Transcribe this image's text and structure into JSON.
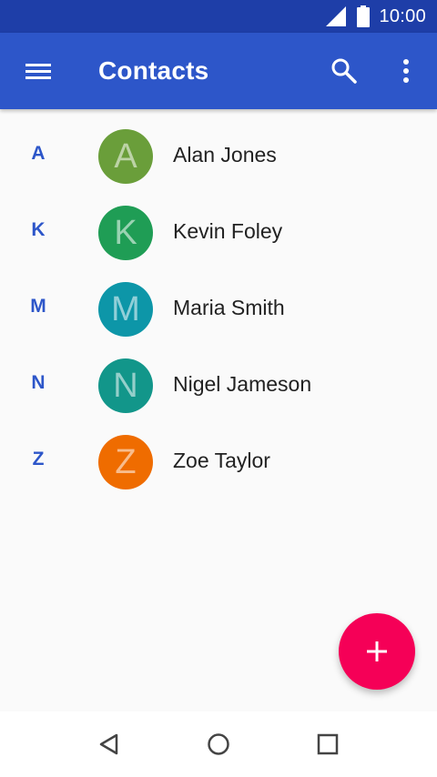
{
  "status_bar": {
    "time": "10:00",
    "signal_icon": "signal-full-icon",
    "battery_icon": "battery-full-icon"
  },
  "app_bar": {
    "title": "Contacts",
    "menu_icon": "hamburger-menu-icon",
    "search_icon": "search-icon",
    "more_icon": "more-vert-icon",
    "background": "#2d56c9"
  },
  "contacts": [
    {
      "section": "A",
      "initial": "A",
      "name": "Alan Jones",
      "color": "#6a9e3a"
    },
    {
      "section": "K",
      "initial": "K",
      "name": "Kevin Foley",
      "color": "#1f9d55"
    },
    {
      "section": "M",
      "initial": "M",
      "name": "Maria Smith",
      "color": "#0d96a8"
    },
    {
      "section": "N",
      "initial": "N",
      "name": "Nigel Jameson",
      "color": "#12968a"
    },
    {
      "section": "Z",
      "initial": "Z",
      "name": "Zoe Taylor",
      "color": "#ef6c00"
    }
  ],
  "fab": {
    "icon": "add-icon",
    "color": "#f50057"
  },
  "nav_bar": {
    "back_icon": "back-triangle-icon",
    "home_icon": "home-circle-icon",
    "recents_icon": "recents-square-icon"
  }
}
